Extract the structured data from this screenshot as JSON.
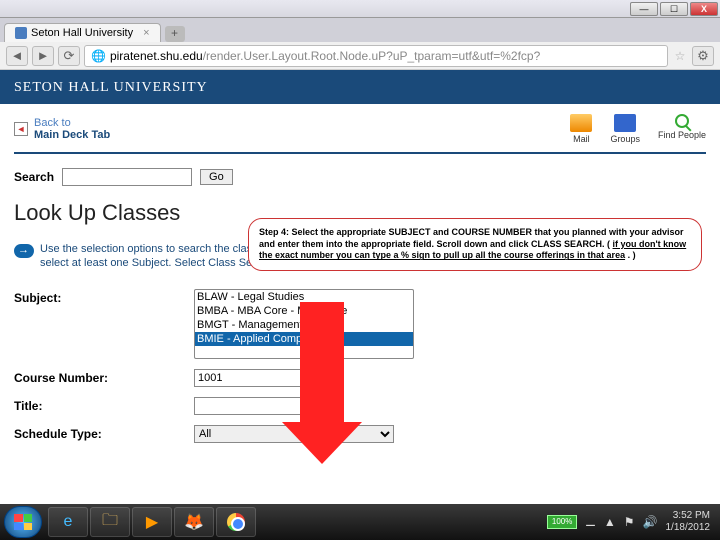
{
  "window": {
    "tab_title": "Seton Hall University",
    "url_host": "piratenet.shu.edu",
    "url_path": "/render.User.Layout.Root.Node.uP?uP_tparam=utf&utf=%2fcp?"
  },
  "banner": {
    "text": "SETON HALL UNIVERSITY"
  },
  "backlink": {
    "line1": "Back to",
    "line2": "Main Deck Tab"
  },
  "utils": {
    "mail": "Mail",
    "groups": "Groups",
    "find": "Find People"
  },
  "search": {
    "label": "Search",
    "go": "Go"
  },
  "page_title": "Look Up Classes",
  "info_text": "Use the selection options to search the class schedule. You may choose any combination of fields to narrow your search, but you must select at least one Subject. Select Class Search when your selection is complete.",
  "form": {
    "subject_label": "Subject:",
    "subject_options": [
      "BLAW - Legal Studies",
      "BMBA - MBA Core - MBA Core",
      "BMGT - Management",
      "BMIE - Applied Computing"
    ],
    "course_label": "Course Number:",
    "course_value": "1001",
    "title_label": "Title:",
    "title_value": "",
    "sched_label": "Schedule Type:",
    "sched_value": "All"
  },
  "callout": {
    "prefix": "Step 4: Select the appropriate SUBJECT and COURSE NUMBER that you planned with your advisor and enter them into the appropriate field.  Scroll down and click CLASS SEARCH. ( ",
    "underlined": "if you don't know the exact number you can type a % sign to pull up all the course offerings in that area",
    "suffix": " . )"
  },
  "taskbar": {
    "battery": "100%",
    "time": "3:52 PM",
    "date": "1/18/2012"
  }
}
